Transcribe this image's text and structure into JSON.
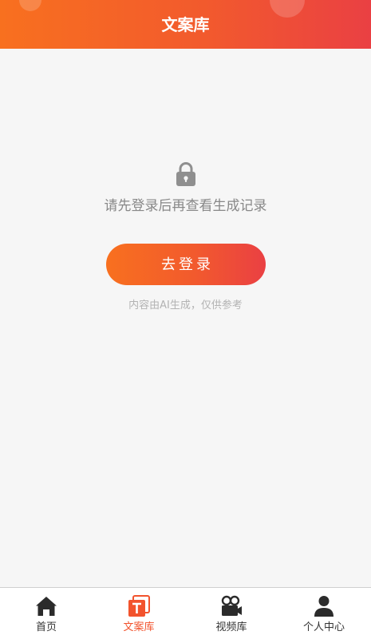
{
  "header": {
    "title": "文案库",
    "gradient_start": "#f8701f",
    "gradient_end": "#ea4043"
  },
  "main": {
    "lock_icon": "lock-icon",
    "prompt": "请先登录后再查看生成记录",
    "login_button_label": "去登录",
    "disclaimer": "内容由AI生成，仅供参考"
  },
  "tabbar": {
    "active_color": "#f2532d",
    "items": [
      {
        "label": "首页",
        "icon": "home-icon",
        "active": false
      },
      {
        "label": "文案库",
        "icon": "copy-library-icon",
        "active": true
      },
      {
        "label": "视频库",
        "icon": "video-camera-icon",
        "active": false
      },
      {
        "label": "个人中心",
        "icon": "user-icon",
        "active": false
      }
    ]
  }
}
